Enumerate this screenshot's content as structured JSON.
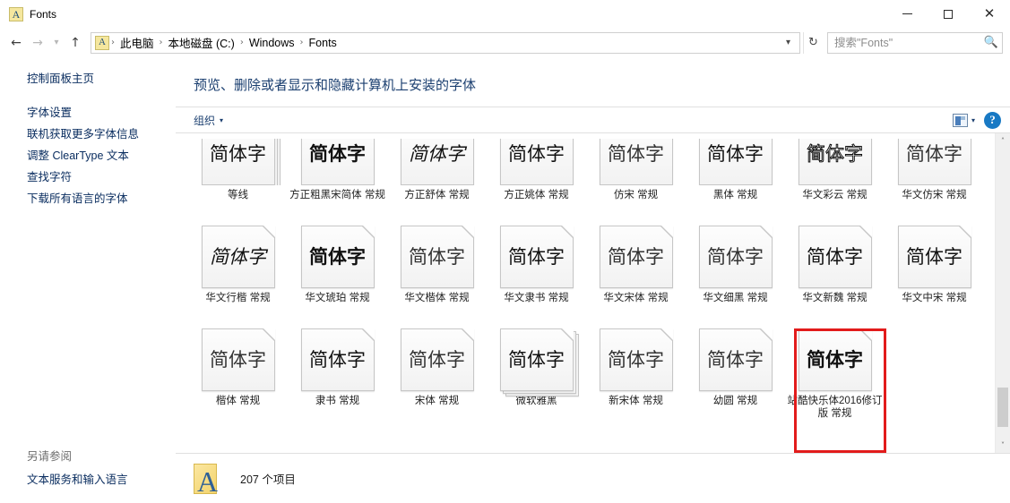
{
  "window": {
    "title": "Fonts",
    "icon": "font-file-icon",
    "controls": {
      "minimize": "—",
      "maximize": "□",
      "close": "✕"
    }
  },
  "addressbar": {
    "back_icon": "←",
    "forward_icon": "→",
    "history_icon": "⌵",
    "up_icon": "↑",
    "breadcrumb": [
      "此电脑",
      "本地磁盘 (C:)",
      "Windows",
      "Fonts"
    ],
    "separator": "›",
    "dropdown_icon": "⌵",
    "refresh_icon": "↻",
    "search": {
      "placeholder": "搜索\"Fonts\"",
      "value": "",
      "icon": "search-icon"
    }
  },
  "sidebar": {
    "primary": [
      {
        "label": "控制面板主页"
      }
    ],
    "links": [
      {
        "label": "字体设置"
      },
      {
        "label": "联机获取更多字体信息"
      },
      {
        "label": "调整 ClearType 文本"
      },
      {
        "label": "查找字符"
      },
      {
        "label": "下载所有语言的字体"
      }
    ],
    "footer_heading": "另请参阅",
    "footer_links": [
      {
        "label": "文本服务和输入语言"
      }
    ]
  },
  "content": {
    "heading": "预览、删除或者显示和隐藏计算机上安装的字体",
    "toolbar": {
      "organize_label": "组织",
      "organize_caret": "▾",
      "view_icon": "view-layout-icon",
      "view_caret": "▾",
      "help_label": "?"
    },
    "preview_text": "简体字",
    "fonts": [
      {
        "name": "等线",
        "stacked": true,
        "style": "sans",
        "clipped": true
      },
      {
        "name": "方正粗黑宋简体 常规",
        "stacked": false,
        "style": "sans bold",
        "clipped": true
      },
      {
        "name": "方正舒体 常规",
        "stacked": false,
        "style": "serif italic",
        "clipped": true
      },
      {
        "name": "方正姚体 常规",
        "stacked": false,
        "style": "serif",
        "clipped": true
      },
      {
        "name": "仿宋 常规",
        "stacked": false,
        "style": "serif thin",
        "clipped": true
      },
      {
        "name": "黑体 常规",
        "stacked": false,
        "style": "sans",
        "clipped": true
      },
      {
        "name": "华文彩云 常规",
        "stacked": false,
        "style": "sans outline",
        "clipped": true
      },
      {
        "name": "华文仿宋 常规",
        "stacked": false,
        "style": "serif thin",
        "clipped": true
      },
      {
        "name": "华文行楷 常规",
        "stacked": false,
        "style": "serif italic"
      },
      {
        "name": "华文琥珀 常规",
        "stacked": false,
        "style": "sans bold"
      },
      {
        "name": "华文楷体 常规",
        "stacked": false,
        "style": "serif thin"
      },
      {
        "name": "华文隶书 常规",
        "stacked": false,
        "style": "serif"
      },
      {
        "name": "华文宋体 常规",
        "stacked": false,
        "style": "serif thin"
      },
      {
        "name": "华文细黑 常规",
        "stacked": false,
        "style": "sans thin"
      },
      {
        "name": "华文新魏 常规",
        "stacked": false,
        "style": "serif"
      },
      {
        "name": "华文中宋 常规",
        "stacked": false,
        "style": "serif"
      },
      {
        "name": "楷体 常规",
        "stacked": false,
        "style": "serif thin"
      },
      {
        "name": "隶书 常规",
        "stacked": false,
        "style": "serif"
      },
      {
        "name": "宋体 常规",
        "stacked": false,
        "style": "serif thin"
      },
      {
        "name": "微软雅黑",
        "stacked": true,
        "style": "sans"
      },
      {
        "name": "新宋体 常规",
        "stacked": false,
        "style": "serif thin"
      },
      {
        "name": "幼圆 常规",
        "stacked": false,
        "style": "sans thin"
      },
      {
        "name": "站酷快乐体2016修订版 常规",
        "stacked": false,
        "style": "sans bold",
        "highlighted": true
      }
    ],
    "scrollbar": {
      "up_icon": "˄",
      "down_icon": "˅"
    }
  },
  "statusbar": {
    "icon": "fonts-folder-icon",
    "text": "207 个项目"
  },
  "colors": {
    "heading": "#1b3f70",
    "link": "#0b2e60",
    "highlight": "#e21b1b",
    "help_blue": "#1879c4"
  }
}
